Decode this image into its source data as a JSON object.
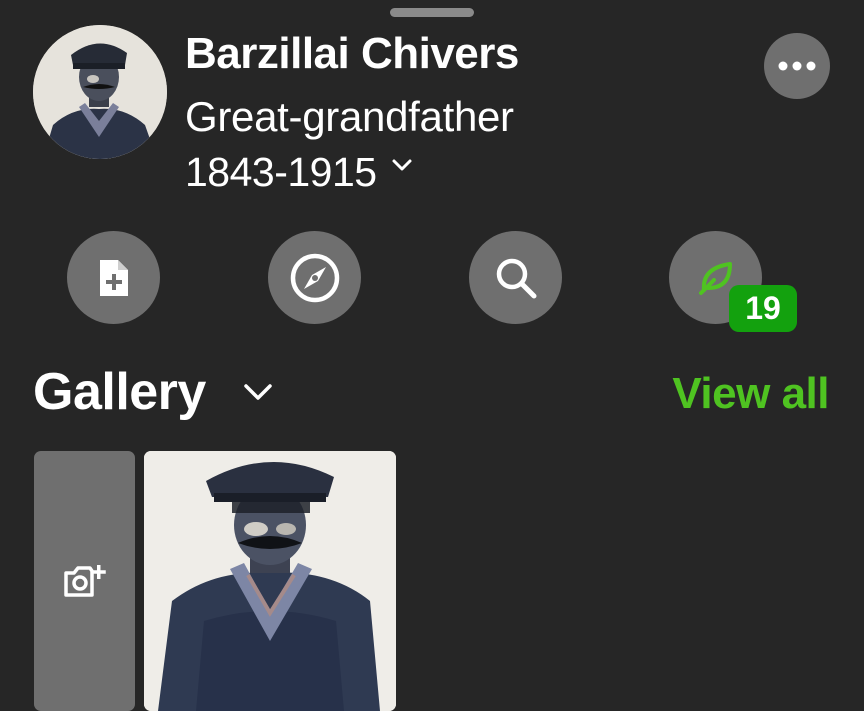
{
  "person": {
    "name": "Barzillai Chivers",
    "relation": "Great-grandfather",
    "dates": "1843-1915"
  },
  "actions": [
    {
      "icon": "add-document-icon"
    },
    {
      "icon": "compass-icon"
    },
    {
      "icon": "search-icon"
    },
    {
      "icon": "leaf-hint-icon",
      "badge": "19"
    }
  ],
  "gallery": {
    "title": "Gallery",
    "view_all_label": "View all"
  },
  "colors": {
    "background": "#262626",
    "button": "#6f6f6f",
    "accent_green": "#4fc321",
    "badge_green": "#13a10e"
  }
}
